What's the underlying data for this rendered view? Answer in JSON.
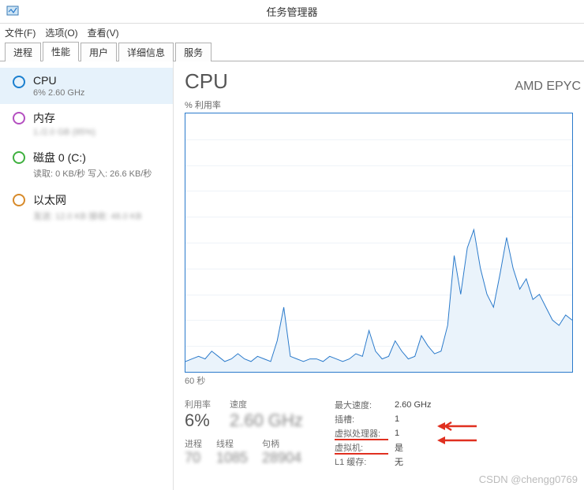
{
  "window": {
    "title": "任务管理器"
  },
  "menu": {
    "file": "文件(F)",
    "options": "选项(O)",
    "view": "查看(V)"
  },
  "tabs": {
    "processes": "进程",
    "performance": "性能",
    "users": "用户",
    "details": "详细信息",
    "services": "服务"
  },
  "sidebar": {
    "cpu": {
      "title": "CPU",
      "sub": "6% 2.60 GHz"
    },
    "memory": {
      "title": "内存",
      "sub": "1./2.0 GB (85%)"
    },
    "disk": {
      "title": "磁盘 0 (C:)",
      "sub": "读取: 0 KB/秒 写入: 26.6 KB/秒"
    },
    "ethernet": {
      "title": "以太网",
      "sub": "发送: 12.0 KB 接收: 48.0 KB"
    }
  },
  "main": {
    "title": "CPU",
    "model": "AMD EPYC",
    "util_label": "% 利用率",
    "time_label": "60 秒"
  },
  "chart_data": {
    "type": "area",
    "xlabel": "60 秒",
    "ylabel": "% 利用率",
    "ylim": [
      0,
      100
    ],
    "x": [
      0,
      1,
      2,
      3,
      4,
      5,
      6,
      7,
      8,
      9,
      10,
      11,
      12,
      13,
      14,
      15,
      16,
      17,
      18,
      19,
      20,
      21,
      22,
      23,
      24,
      25,
      26,
      27,
      28,
      29,
      30,
      31,
      32,
      33,
      34,
      35,
      36,
      37,
      38,
      39,
      40,
      41,
      42,
      43,
      44,
      45,
      46,
      47,
      48,
      49,
      50,
      51,
      52,
      53,
      54,
      55,
      56,
      57,
      58,
      59
    ],
    "values": [
      4,
      5,
      6,
      5,
      8,
      6,
      4,
      5,
      7,
      5,
      4,
      6,
      5,
      4,
      12,
      25,
      6,
      5,
      4,
      5,
      5,
      4,
      6,
      5,
      4,
      5,
      7,
      6,
      16,
      8,
      5,
      6,
      12,
      8,
      5,
      6,
      14,
      10,
      7,
      8,
      18,
      45,
      30,
      48,
      55,
      40,
      30,
      25,
      38,
      52,
      40,
      32,
      36,
      28,
      30,
      25,
      20,
      18,
      22,
      20
    ]
  },
  "stats": {
    "util_lbl": "利用率",
    "util_val": "6%",
    "speed_lbl": "速度",
    "speed_val": "2.60 GHz",
    "proc_lbl": "进程",
    "proc_val": "70",
    "thr_lbl": "线程",
    "thr_val": "1085",
    "hnd_lbl": "句柄",
    "hnd_val": "28904"
  },
  "kv": {
    "max_speed_k": "最大速度:",
    "max_speed_v": "2.60 GHz",
    "sockets_k": "插槽:",
    "sockets_v": "1",
    "vproc_k": "虚拟处理器:",
    "vproc_v": "1",
    "vm_k": "虚拟机:",
    "vm_v": "是",
    "l1_k": "L1 缓存:",
    "l1_v": "无"
  },
  "watermark": "CSDN @chengg0769"
}
